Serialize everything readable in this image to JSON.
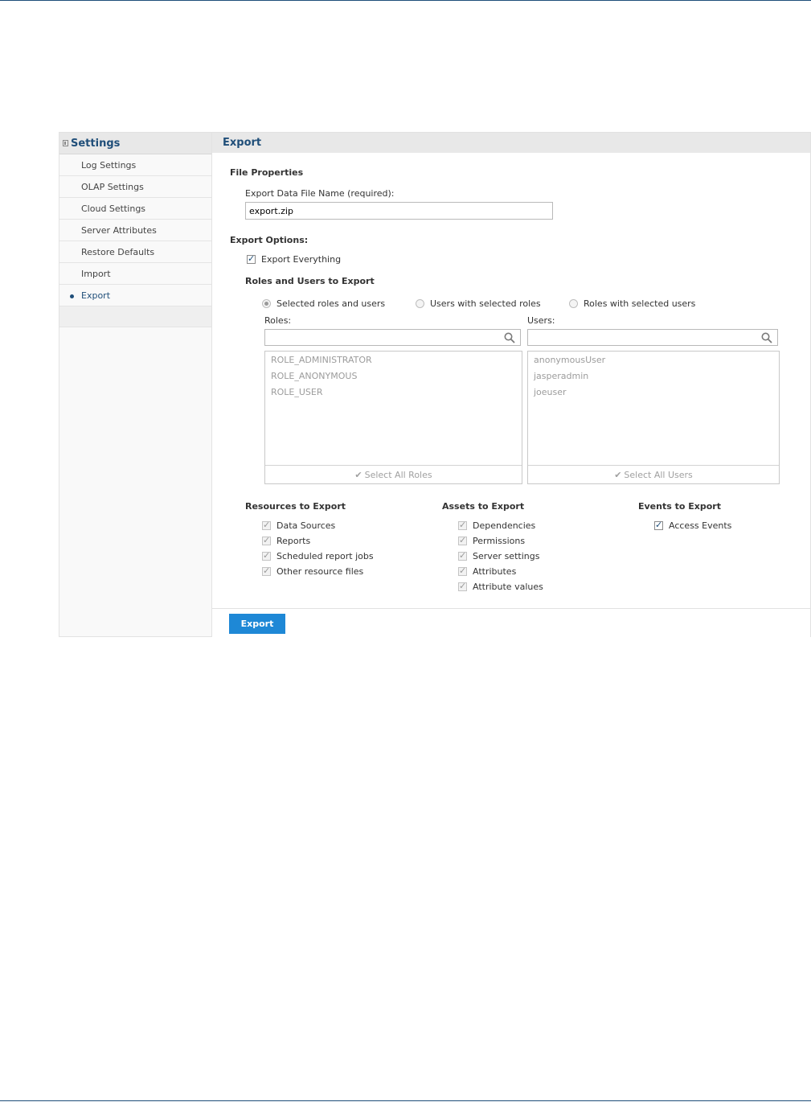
{
  "sidebar": {
    "title": "Settings",
    "items": [
      {
        "label": "Log Settings",
        "active": false
      },
      {
        "label": "OLAP Settings",
        "active": false
      },
      {
        "label": "Cloud Settings",
        "active": false
      },
      {
        "label": "Server Attributes",
        "active": false
      },
      {
        "label": "Restore Defaults",
        "active": false
      },
      {
        "label": "Import",
        "active": false
      },
      {
        "label": "Export",
        "active": true
      }
    ]
  },
  "main": {
    "title": "Export",
    "file_properties": {
      "section_title": "File Properties",
      "file_name_label": "Export Data File Name (required):",
      "file_name_value": "export.zip"
    },
    "export_options": {
      "section_title": "Export Options:",
      "export_everything_label": "Export Everything",
      "export_everything_checked": true
    },
    "roles_users": {
      "section_title": "Roles and Users to Export",
      "radio_options": [
        {
          "label": "Selected roles and users",
          "selected": true
        },
        {
          "label": "Users with selected roles",
          "selected": false
        },
        {
          "label": "Roles with selected users",
          "selected": false
        }
      ],
      "roles_label": "Roles:",
      "users_label": "Users:",
      "roles": [
        "ROLE_ADMINISTRATOR",
        "ROLE_ANONYMOUS",
        "ROLE_USER"
      ],
      "users": [
        "anonymousUser",
        "jasperadmin",
        "joeuser"
      ],
      "select_all_roles": "Select All Roles",
      "select_all_users": "Select All Users"
    },
    "resources": {
      "title": "Resources to Export",
      "items": [
        "Data Sources",
        "Reports",
        "Scheduled report jobs",
        "Other resource files"
      ]
    },
    "assets": {
      "title": "Assets to Export",
      "items": [
        "Dependencies",
        "Permissions",
        "Server settings",
        "Attributes",
        "Attribute values"
      ]
    },
    "events": {
      "title": "Events to Export",
      "items": [
        "Access Events"
      ]
    },
    "export_button": "Export"
  },
  "icons": {
    "collapse": "collapse-icon",
    "search": "search-icon",
    "check": "check-icon"
  },
  "colors": {
    "accent": "#1f4e79",
    "button": "#1e88d6"
  }
}
